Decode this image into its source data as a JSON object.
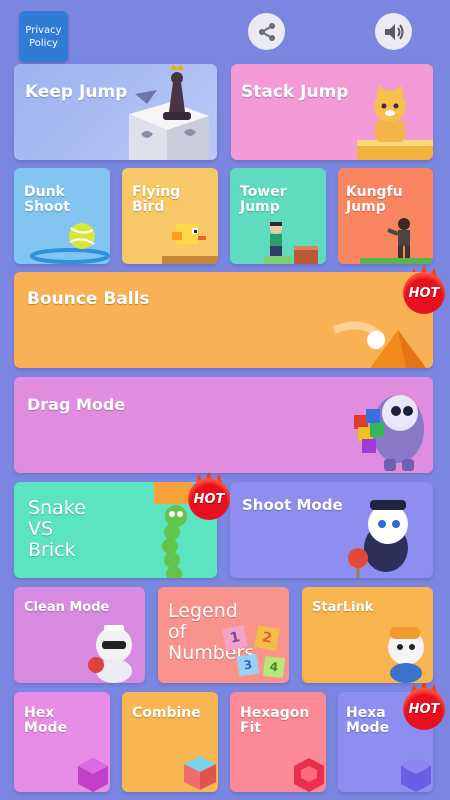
{
  "header": {
    "privacy_line1": "Privacy",
    "privacy_line2": "Policy"
  },
  "badges": {
    "hot": "HOT"
  },
  "tiles": {
    "keep_jump": "Keep Jump",
    "stack_jump": "Stack Jump",
    "dunk_shoot": "Dunk\nShoot",
    "flying_bird": "Flying\nBird",
    "tower_jump": "Tower\nJump",
    "kungfu_jump": "Kungfu\nJump",
    "bounce_balls": "Bounce Balls",
    "drag_mode": "Drag Mode",
    "snake_vs_brick": "Snake\nVS\nBrick",
    "shoot_mode": "Shoot Mode",
    "clean_mode": "Clean Mode",
    "legend_of_numbers": "Legend\nof\nNumbers",
    "starlink": "StarLink",
    "hex_mode": "Hex\nMode",
    "combine": "Combine",
    "hexagon_fit": "Hexagon\nFit",
    "hexa_mode": "Hexa\nMode"
  },
  "number_blocks": [
    "1",
    "2",
    "3",
    "4"
  ]
}
